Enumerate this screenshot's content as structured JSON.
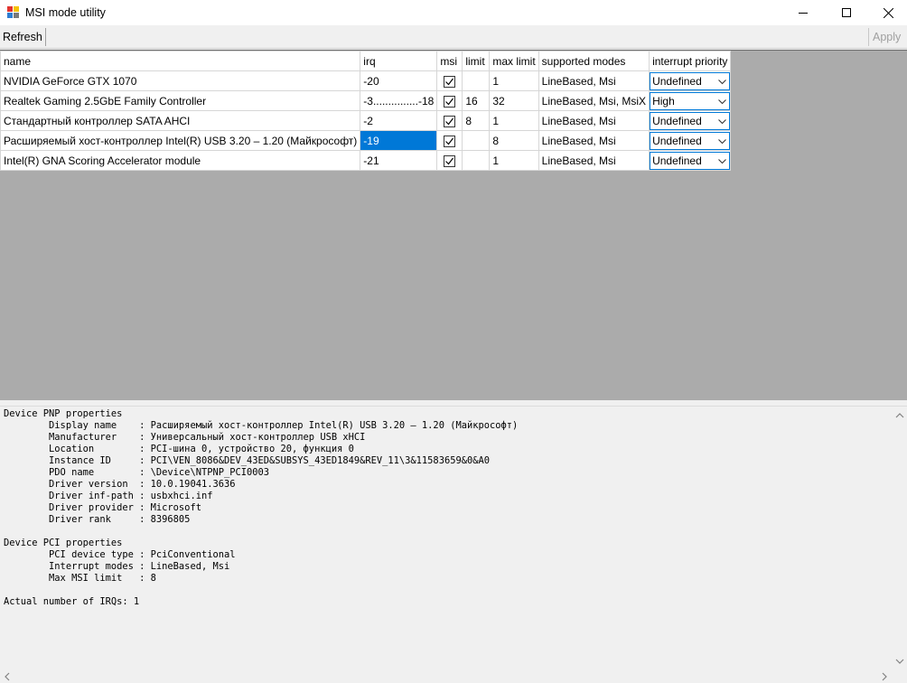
{
  "window": {
    "title": "MSI mode utility",
    "icon": "app-window-icon"
  },
  "toolbar": {
    "refresh_label": "Refresh",
    "apply_label": "Apply"
  },
  "grid": {
    "columns": [
      "name",
      "irq",
      "msi",
      "limit",
      "max limit",
      "supported modes",
      "interrupt priority"
    ],
    "rows": [
      {
        "name": "NVIDIA GeForce GTX 1070",
        "irq": "-20",
        "msi": true,
        "limit": "",
        "max_limit": "1",
        "modes": "LineBased, Msi",
        "priority": "Undefined"
      },
      {
        "name": "Realtek Gaming 2.5GbE Family Controller",
        "irq": "-3...............-18",
        "msi": true,
        "limit": "16",
        "max_limit": "32",
        "modes": "LineBased, Msi, MsiX",
        "priority": "High"
      },
      {
        "name": "Стандартный контроллер SATA AHCI",
        "irq": "-2",
        "msi": true,
        "limit": "8",
        "max_limit": "1",
        "modes": "LineBased, Msi",
        "priority": "Undefined"
      },
      {
        "name": "Расширяемый хост-контроллер Intel(R) USB 3.20 – 1.20 (Майкрософт)",
        "irq": "-19",
        "msi": true,
        "limit": "",
        "max_limit": "8",
        "modes": "LineBased, Msi",
        "priority": "Undefined"
      },
      {
        "name": "Intel(R) GNA Scoring Accelerator module",
        "irq": "-21",
        "msi": true,
        "limit": "",
        "max_limit": "1",
        "modes": "LineBased, Msi",
        "priority": "Undefined"
      }
    ],
    "selected_row": 3
  },
  "details": {
    "lines": [
      "Device PNP properties",
      "        Display name    : Расширяемый хост-контроллер Intel(R) USB 3.20 – 1.20 (Майкрософт)",
      "        Manufacturer    : Универсальный хост-контроллер USB xHCI",
      "        Location        : PCI-шина 0, устройство 20, функция 0",
      "        Instance ID     : PCI\\VEN_8086&DEV_43ED&SUBSYS_43ED1849&REV_11\\3&11583659&0&A0",
      "        PDO name        : \\Device\\NTPNP_PCI0003",
      "        Driver version  : 10.0.19041.3636",
      "        Driver inf-path : usbxhci.inf",
      "        Driver provider : Microsoft",
      "        Driver rank     : 8396805",
      "",
      "Device PCI properties",
      "        PCI device type : PciConventional",
      "        Interrupt modes : LineBased, Msi",
      "        Max MSI limit   : 8",
      "",
      "Actual number of IRQs: 1"
    ]
  },
  "colors": {
    "selection": "#0078d7",
    "grid_background": "#ababab"
  }
}
